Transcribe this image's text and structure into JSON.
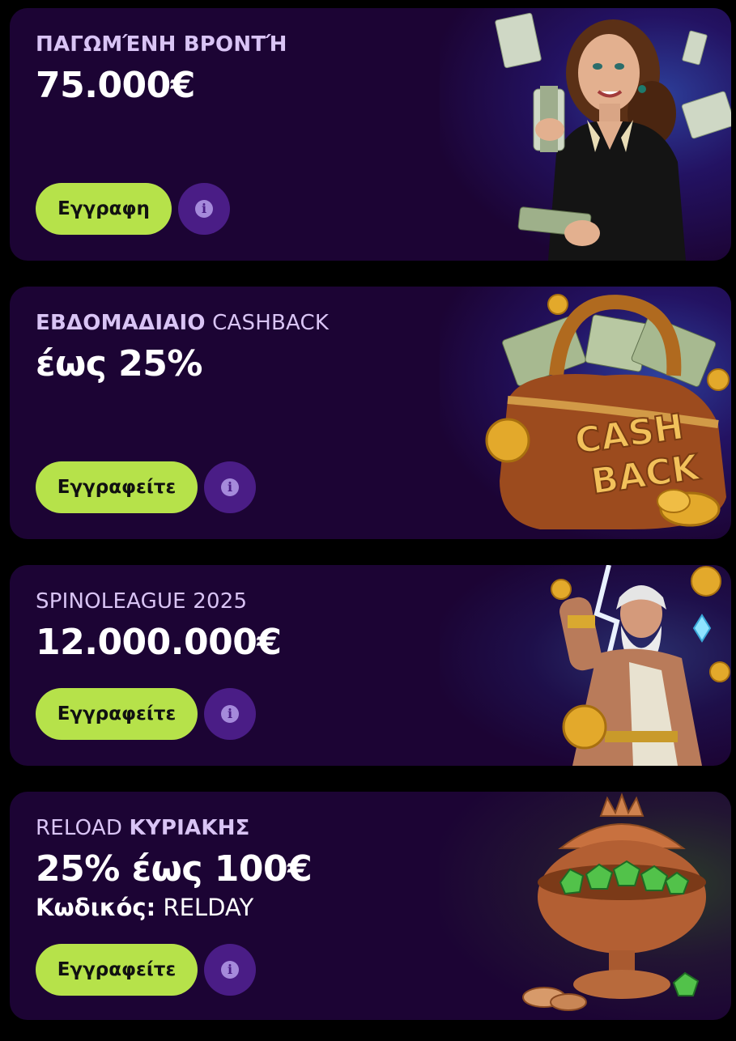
{
  "promos": [
    {
      "subtitle_bold": "ΠΑΓΩΜΈΝΗ ΒΡΟΝΤΉ",
      "subtitle_rest": "",
      "title": "75.000€",
      "button_label": "Εγγραφη",
      "info_glyph": "i",
      "illustration": "woman-with-money"
    },
    {
      "subtitle_bold": "ΕΒΔΟΜΑΔΙΑΙΟ",
      "subtitle_rest": " CASHBACK",
      "title": "έως 25%",
      "button_label": "Εγγραφείτε",
      "info_glyph": "i",
      "illustration": "cashback-bag",
      "illustration_text": [
        "CASH",
        "BACK"
      ]
    },
    {
      "subtitle_bold": "",
      "subtitle_rest": "SPINOLEAGUE 2025",
      "title": "12.000.000€",
      "button_label": "Εγγραφείτε",
      "info_glyph": "i",
      "illustration": "zeus-lightning"
    },
    {
      "subtitle_rest_before": "RELOAD ",
      "subtitle_bold": "ΚΥΡΙΑΚΗΣ",
      "title": "25% έως 100€",
      "code_label": "Κωδικός:",
      "code_value": " RELDAY",
      "button_label": "Εγγραφείτε",
      "info_glyph": "i",
      "illustration": "emerald-pot"
    }
  ],
  "colors": {
    "page_bg": "#000000",
    "card_bg": "#1c0434",
    "button_bg": "#b6e24a",
    "info_bg": "#4a1d86",
    "subtitle": "#d9c4f5"
  }
}
